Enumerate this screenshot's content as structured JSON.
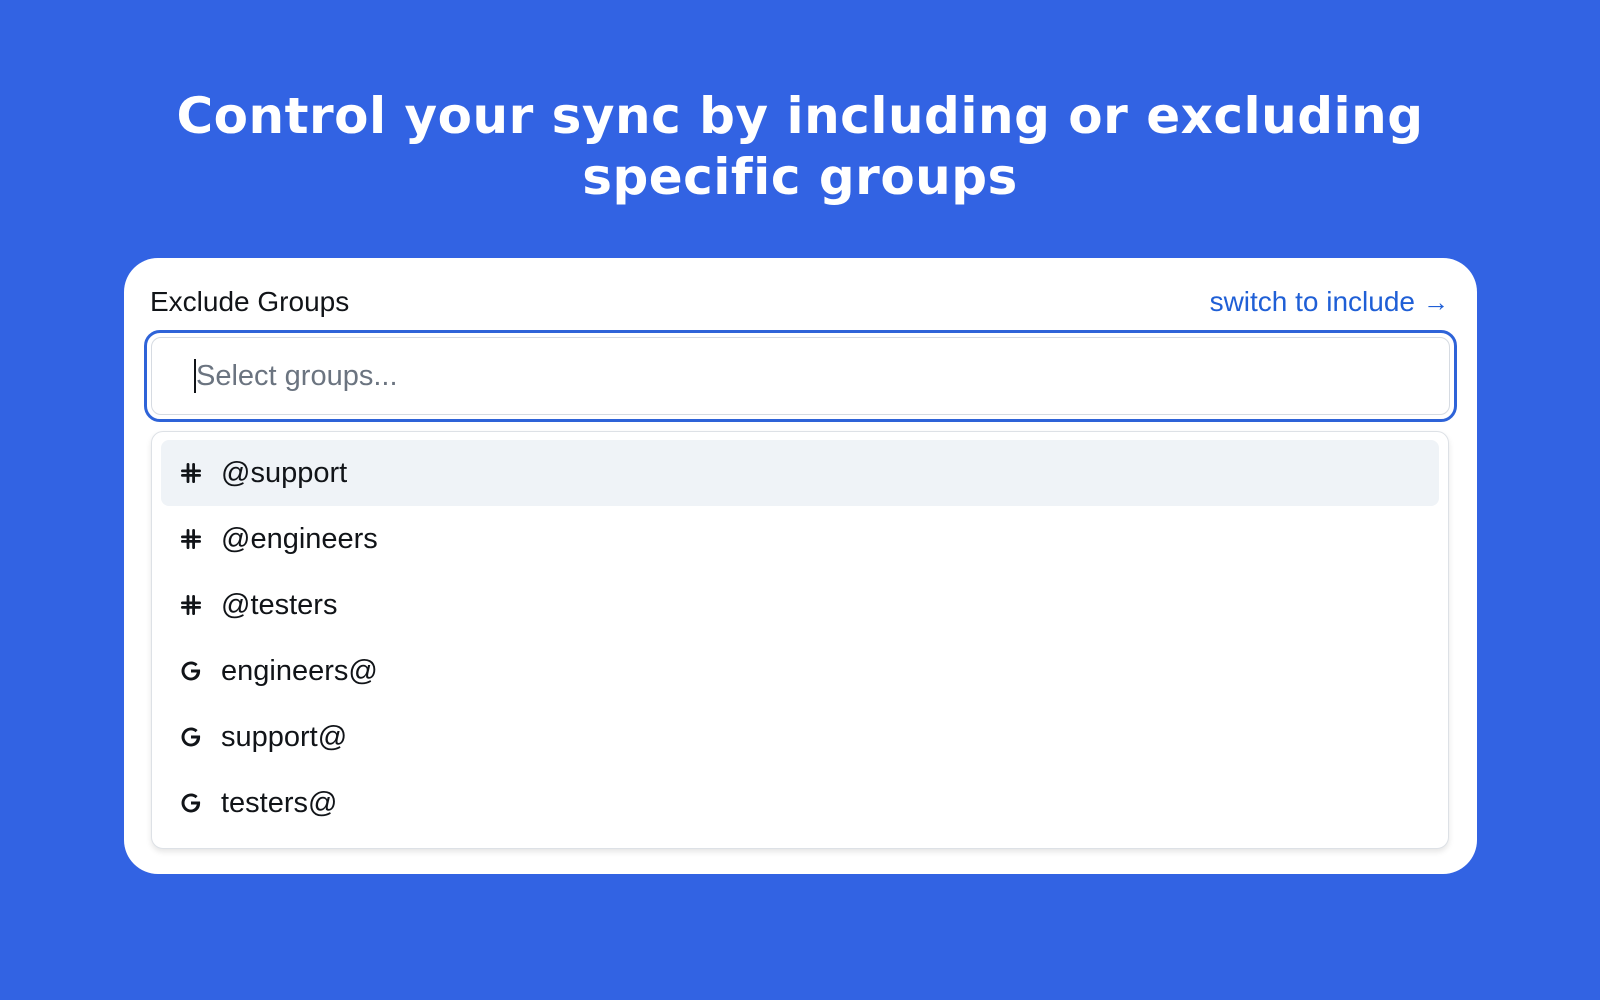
{
  "headline": {
    "line1": "Control your sync by including or excluding",
    "line2": "specific groups"
  },
  "picker": {
    "label": "Exclude Groups",
    "switch_link": "switch to include",
    "switch_arrow": "→",
    "placeholder": "Select groups..."
  },
  "options": [
    {
      "label": "@support",
      "icon": "slack-icon",
      "highlighted": true
    },
    {
      "label": "@engineers",
      "icon": "slack-icon"
    },
    {
      "label": "@testers",
      "icon": "slack-icon"
    },
    {
      "label": "engineers@",
      "icon": "google-icon"
    },
    {
      "label": "support@",
      "icon": "google-icon"
    },
    {
      "label": "testers@",
      "icon": "google-icon"
    }
  ],
  "colors": {
    "background": "#3263e3",
    "accent": "#1f5fd6",
    "highlight": "#eff3f7"
  }
}
